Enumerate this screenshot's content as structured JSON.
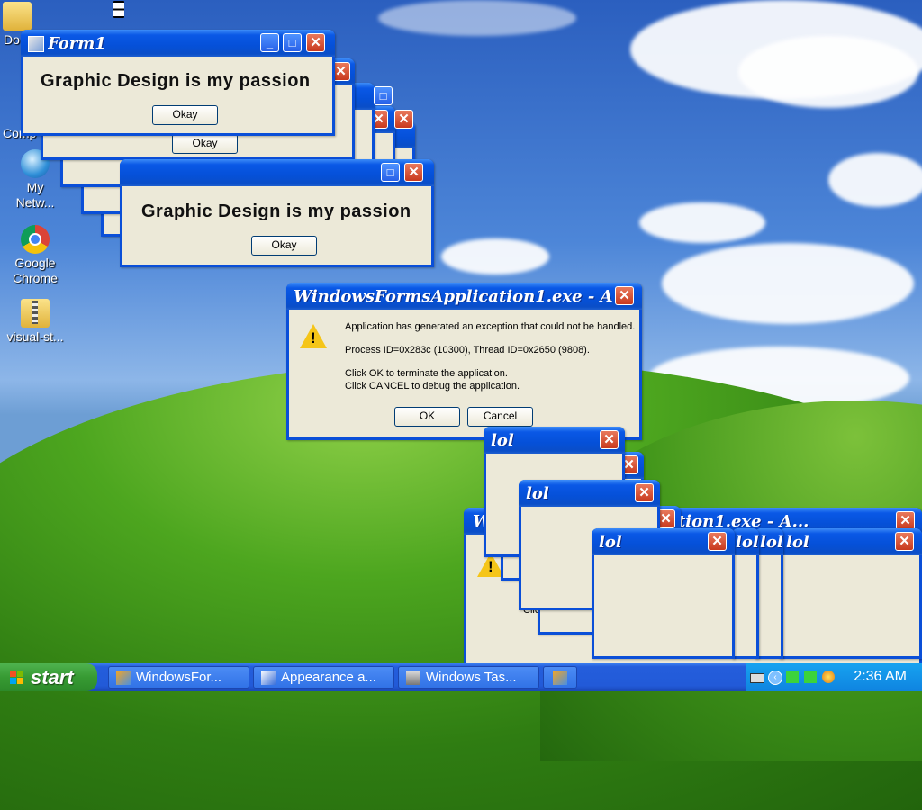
{
  "desktop": {
    "icons": [
      {
        "label": "Do",
        "icon": "folder-icon"
      },
      {
        "label": "Comp",
        "icon": "computer-icon"
      },
      {
        "label": "My Netw...",
        "icon": "network-icon"
      },
      {
        "label": "Google Chrome",
        "icon": "chrome-icon"
      },
      {
        "label": "visual-st...",
        "icon": "zip-folder-icon"
      }
    ]
  },
  "forms": {
    "title": "Form1",
    "message": "Graphic Design is my passion",
    "button": "Okay"
  },
  "error": {
    "title": "WindowsFormsApplication1.exe - A...",
    "line1": "Application has generated an exception that could not be handled.",
    "line2": "Process ID=0x283c (10300), Thread ID=0x2650 (9808).",
    "line3": "Click OK to terminate the application.",
    "line4": "Click CANCEL to debug the application.",
    "ok": "OK",
    "cancel": "Cancel",
    "fragment": "Clic"
  },
  "lol": {
    "title": "lol"
  },
  "taskbar": {
    "start": "start",
    "tasks": [
      "WindowsFor...",
      "Appearance a...",
      "Windows Tas..."
    ],
    "clock": "2:36 AM"
  },
  "colors": {
    "titlebar": "#0550d8",
    "close": "#c8391e",
    "start": "#379a33",
    "tray": "#0f84e0"
  }
}
